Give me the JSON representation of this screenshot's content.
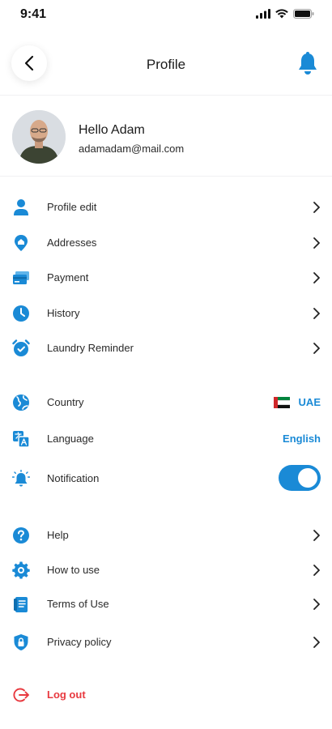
{
  "status": {
    "time": "9:41"
  },
  "header": {
    "title": "Profile"
  },
  "profile": {
    "greeting": "Hello Adam",
    "email": "adamadam@mail.com"
  },
  "menu_primary": [
    {
      "label": "Profile edit",
      "icon": "person-icon"
    },
    {
      "label": "Addresses",
      "icon": "location-pin-icon"
    },
    {
      "label": "Payment",
      "icon": "credit-card-icon"
    },
    {
      "label": "History",
      "icon": "clock-icon"
    },
    {
      "label": "Laundry Reminder",
      "icon": "alarm-icon"
    }
  ],
  "settings": {
    "country": {
      "label": "Country",
      "value": "UAE",
      "flag": "uae-flag"
    },
    "language": {
      "label": "Language",
      "value": "English"
    },
    "notification": {
      "label": "Notification",
      "enabled": true
    }
  },
  "menu_support": [
    {
      "label": "Help",
      "icon": "question-icon"
    },
    {
      "label": "How to use",
      "icon": "gear-icon"
    },
    {
      "label": "Terms of Use",
      "icon": "document-icon"
    },
    {
      "label": "Privacy policy",
      "icon": "shield-lock-icon"
    }
  ],
  "logout": {
    "label": "Log out",
    "icon": "logout-icon"
  },
  "colors": {
    "accent": "#1a8ad6",
    "danger": "#e8393f",
    "text": "#1b1b1b"
  }
}
